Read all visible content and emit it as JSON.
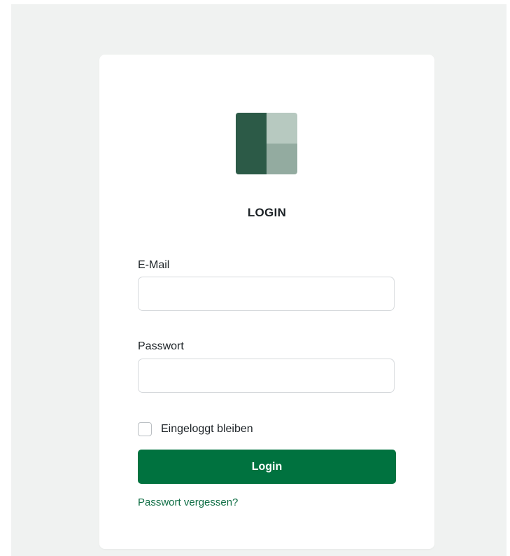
{
  "colors": {
    "page_background": "#f0f2f1",
    "card_background": "#ffffff",
    "logo_dark": "#2c5a47",
    "logo_light": "#b7c9c0",
    "logo_mid": "#93aba0",
    "primary": "#00723f",
    "link": "#0f6e45"
  },
  "logo": {
    "icon": "brand-logo-icon"
  },
  "login": {
    "title": "LOGIN",
    "email_label": "E-Mail",
    "email_value": "",
    "email_placeholder": "",
    "password_label": "Passwort",
    "password_value": "",
    "password_placeholder": "",
    "remember_label": "Eingeloggt bleiben",
    "remember_checked": false,
    "submit_label": "Login",
    "forgot_label": "Passwort vergessen?"
  }
}
